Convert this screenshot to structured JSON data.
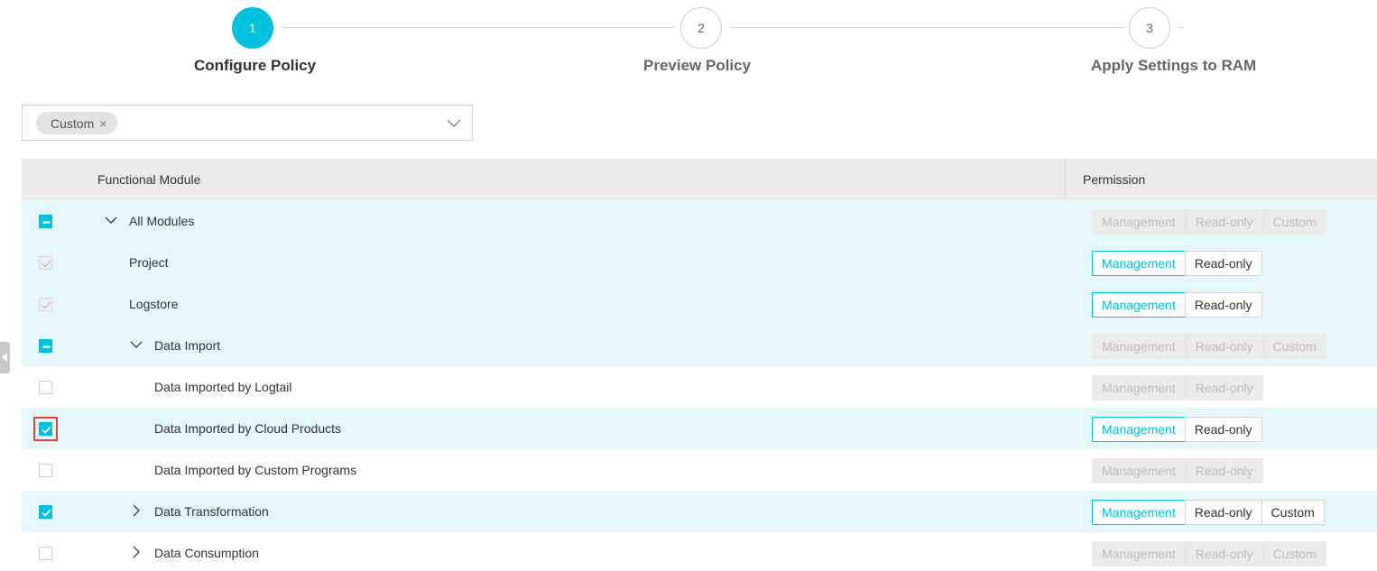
{
  "steps": [
    {
      "number": "1",
      "label": "Configure Policy",
      "active": true
    },
    {
      "number": "2",
      "label": "Preview Policy",
      "active": false
    },
    {
      "number": "3",
      "label": "Apply Settings to RAM",
      "active": false
    }
  ],
  "policy_select": {
    "selected_tag": "Custom",
    "close_glyph": "×"
  },
  "table": {
    "headers": {
      "module": "Functional Module",
      "permission": "Permission"
    },
    "rows": [
      {
        "label": "All Modules",
        "checkbox": "indeterminate",
        "caret": "down",
        "indent": 1,
        "highlight": true,
        "perms": [
          {
            "text": "Management",
            "state": "disabled"
          },
          {
            "text": "Read-only",
            "state": "disabled"
          },
          {
            "text": "Custom",
            "state": "disabled"
          }
        ]
      },
      {
        "label": "Project",
        "checkbox": "checked-disabled",
        "caret": "none",
        "indent": 1,
        "highlight": true,
        "perms": [
          {
            "text": "Management",
            "state": "selected"
          },
          {
            "text": "Read-only",
            "state": "normal"
          }
        ]
      },
      {
        "label": "Logstore",
        "checkbox": "checked-disabled",
        "caret": "none",
        "indent": 1,
        "highlight": true,
        "perms": [
          {
            "text": "Management",
            "state": "selected"
          },
          {
            "text": "Read-only",
            "state": "normal"
          }
        ]
      },
      {
        "label": "Data Import",
        "checkbox": "indeterminate",
        "caret": "down",
        "indent": 2,
        "highlight": true,
        "perms": [
          {
            "text": "Management",
            "state": "disabled"
          },
          {
            "text": "Read-only",
            "state": "disabled"
          },
          {
            "text": "Custom",
            "state": "disabled"
          }
        ]
      },
      {
        "label": "Data Imported by Logtail",
        "checkbox": "unchecked",
        "caret": "none",
        "indent": 2,
        "highlight": false,
        "perms": [
          {
            "text": "Management",
            "state": "disabled"
          },
          {
            "text": "Read-only",
            "state": "disabled"
          }
        ]
      },
      {
        "label": "Data Imported by Cloud Products",
        "checkbox": "checked",
        "caret": "none",
        "indent": 2,
        "highlight": true,
        "focused": true,
        "perms": [
          {
            "text": "Management",
            "state": "selected"
          },
          {
            "text": "Read-only",
            "state": "normal"
          }
        ]
      },
      {
        "label": "Data Imported by Custom Programs",
        "checkbox": "unchecked",
        "caret": "none",
        "indent": 2,
        "highlight": false,
        "perms": [
          {
            "text": "Management",
            "state": "disabled"
          },
          {
            "text": "Read-only",
            "state": "disabled"
          }
        ]
      },
      {
        "label": "Data Transformation",
        "checkbox": "checked",
        "caret": "right",
        "indent": 2,
        "highlight": true,
        "perms": [
          {
            "text": "Management",
            "state": "selected"
          },
          {
            "text": "Read-only",
            "state": "normal"
          },
          {
            "text": "Custom",
            "state": "normal"
          }
        ]
      },
      {
        "label": "Data Consumption",
        "checkbox": "unchecked",
        "caret": "right",
        "indent": 2,
        "highlight": false,
        "perms": [
          {
            "text": "Management",
            "state": "disabled"
          },
          {
            "text": "Read-only",
            "state": "disabled"
          },
          {
            "text": "Custom",
            "state": "disabled"
          }
        ]
      }
    ]
  },
  "colors": {
    "accent": "#00c1de",
    "row_highlight": "#e5f7fb",
    "focus_outline": "#e8433a"
  }
}
